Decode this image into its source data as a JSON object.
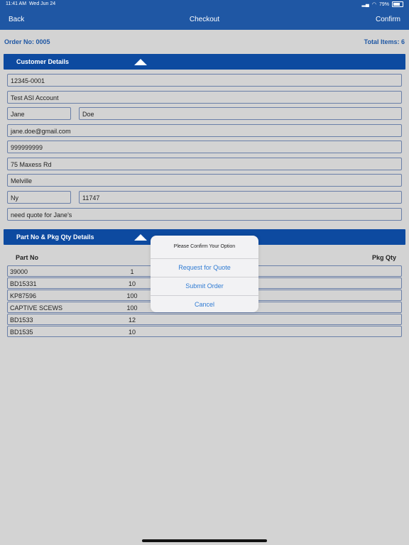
{
  "status_bar": {
    "time": "11:41 AM",
    "date": "Wed Jun 24",
    "battery": "79%"
  },
  "nav": {
    "back": "Back",
    "title": "Checkout",
    "confirm": "Confirm"
  },
  "order": {
    "order_no": "Order No: 0005",
    "total_items": "Total Items: 6"
  },
  "customer_section": {
    "title": "Customer Details",
    "account_number": "12345-0001",
    "account_name": "Test ASI Account",
    "first_name": "Jane",
    "last_name": "Doe",
    "email": "jane.doe@gmail.com",
    "phone": "999999999",
    "address": "75 Maxess Rd",
    "city": "Melville",
    "state": "Ny",
    "zip": "11747",
    "notes": "need quote for Jane's"
  },
  "parts_section": {
    "title": "Part No & Pkg Qty Details",
    "col_part": "Part No",
    "col_qty": "Pkg Qty",
    "rows": [
      {
        "part": "39000",
        "qty": "1"
      },
      {
        "part": "BD15331",
        "qty": "10"
      },
      {
        "part": "KP87596",
        "qty": "100"
      },
      {
        "part": "CAPTIVE SCEWS",
        "qty": "100"
      },
      {
        "part": "BD1533",
        "qty": "12"
      },
      {
        "part": "BD1535",
        "qty": "10"
      }
    ]
  },
  "dialog": {
    "message": "Please Confirm Your Option",
    "request_quote": "Request for Quote",
    "submit_order": "Submit Order",
    "cancel": "Cancel"
  }
}
